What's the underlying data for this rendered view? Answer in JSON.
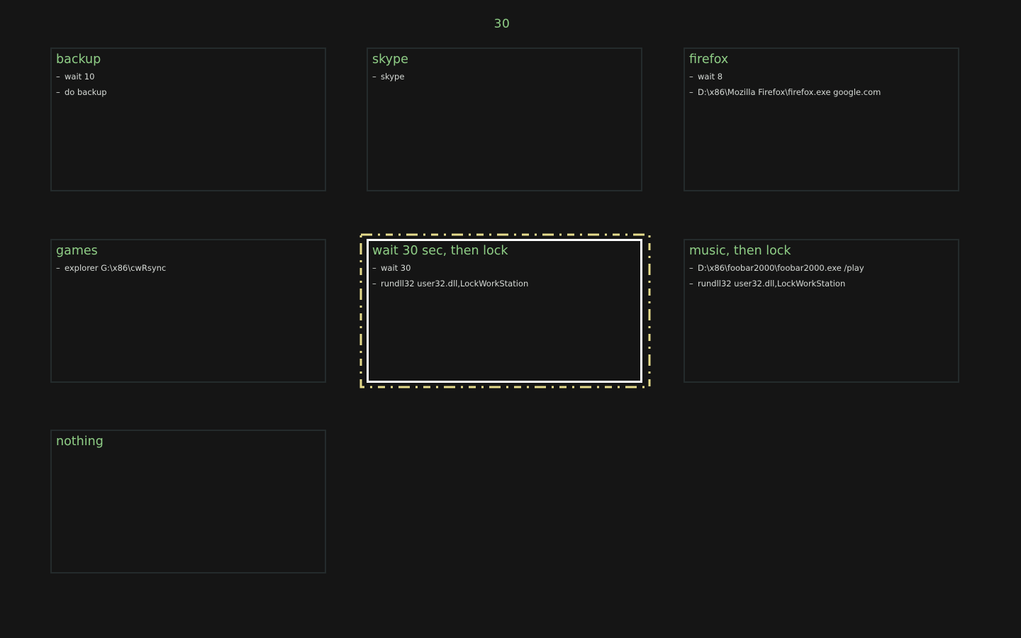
{
  "counter": "30",
  "tiles": [
    {
      "title": "backup",
      "lines": [
        "wait 10",
        "do backup"
      ]
    },
    {
      "title": "skype",
      "lines": [
        "skype"
      ]
    },
    {
      "title": "firefox",
      "lines": [
        "wait 8",
        "D:\\x86\\Mozilla Firefox\\firefox.exe google.com"
      ]
    },
    {
      "title": "games",
      "lines": [
        "explorer G:\\x86\\cwRsync"
      ]
    },
    {
      "title": "wait 30 sec, then lock",
      "lines": [
        "wait 30",
        "rundll32 user32.dll,LockWorkStation"
      ],
      "selected": true
    },
    {
      "title": "music, then lock",
      "lines": [
        "D:\\x86\\foobar2000\\foobar2000.exe /play",
        "rundll32 user32.dll,LockWorkStation"
      ]
    },
    {
      "title": "nothing",
      "lines": []
    }
  ],
  "colors": {
    "background": "#151515",
    "title": "#8fce86",
    "text": "#d6dad6",
    "border": "#242b2c",
    "selected_border": "#ffffff",
    "focus_ring": "#e6dc8c"
  }
}
